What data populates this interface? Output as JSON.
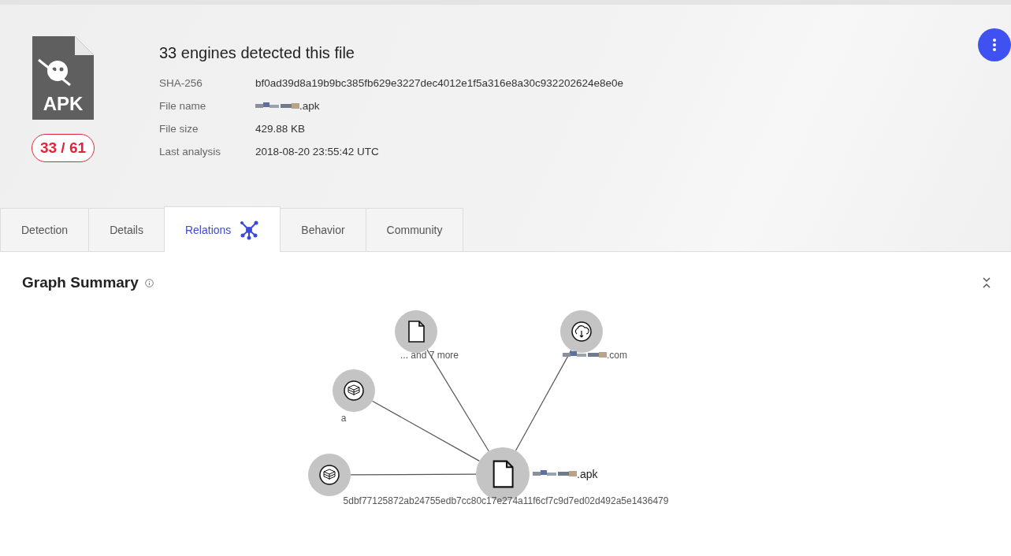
{
  "header": {
    "title": "33 engines detected this file",
    "score": "33 / 61",
    "file_type": "APK",
    "fields": [
      {
        "label": "SHA-256",
        "value": "bf0ad39d8a19b9bc385fb629e3227dec4012e1f5a316e8a30c932202624e8e0e",
        "redacted": false
      },
      {
        "label": "File name",
        "value": ".apk",
        "redacted": true
      },
      {
        "label": "File size",
        "value": "429.88 KB",
        "redacted": false
      },
      {
        "label": "Last analysis",
        "value": "2018-08-20 23:55:42 UTC",
        "redacted": false
      }
    ]
  },
  "tabs": [
    {
      "label": "Detection",
      "selected": false
    },
    {
      "label": "Details",
      "selected": false
    },
    {
      "label": "Relations",
      "selected": true
    },
    {
      "label": "Behavior",
      "selected": false
    },
    {
      "label": "Community",
      "selected": false
    }
  ],
  "section": {
    "title": "Graph Summary"
  },
  "graph": {
    "nodes": [
      {
        "kind": "file",
        "label": ".apk",
        "redacted": true
      },
      {
        "kind": "file",
        "label": "... and 7 more",
        "redacted": false
      },
      {
        "kind": "cloud",
        "label": ".com",
        "redacted": true
      },
      {
        "kind": "box",
        "label": "a",
        "redacted": false
      },
      {
        "kind": "box",
        "label": "5dbf77125872ab24755edb7cc80c17e274a11f6cf7c9d7ed02d492a5e1436479",
        "redacted": false
      }
    ]
  }
}
